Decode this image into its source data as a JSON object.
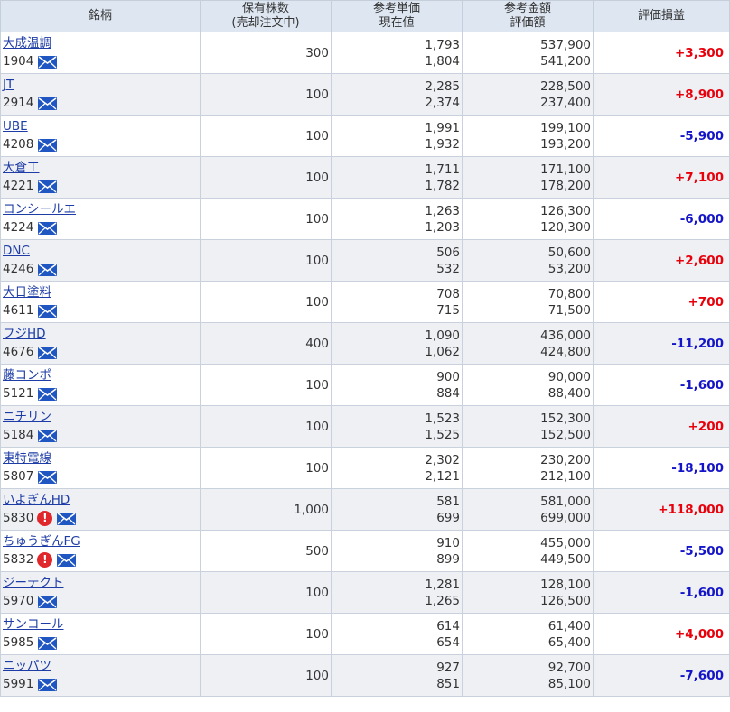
{
  "headers": {
    "col1": "銘柄",
    "col2_line1": "保有株数",
    "col2_line2": "(売却注文中)",
    "col3_line1": "参考単価",
    "col3_line2": "現在値",
    "col4_line1": "参考金額",
    "col4_line2": "評価額",
    "col5": "評価損益"
  },
  "colors": {
    "positive": "#e8000b",
    "negative": "#1414c8",
    "header_bg": "#dde6f1",
    "row_alt_bg": "#eef0f4"
  },
  "rows": [
    {
      "name": "大成温調",
      "code": "1904",
      "alert": false,
      "shares": "300",
      "ref_price": "1,793",
      "cur_price": "1,804",
      "ref_amount": "537,900",
      "cur_amount": "541,200",
      "pl": "+3,300",
      "sign": "pos"
    },
    {
      "name": "JT",
      "code": "2914",
      "alert": false,
      "shares": "100",
      "ref_price": "2,285",
      "cur_price": "2,374",
      "ref_amount": "228,500",
      "cur_amount": "237,400",
      "pl": "+8,900",
      "sign": "pos"
    },
    {
      "name": "UBE",
      "code": "4208",
      "alert": false,
      "shares": "100",
      "ref_price": "1,991",
      "cur_price": "1,932",
      "ref_amount": "199,100",
      "cur_amount": "193,200",
      "pl": "-5,900",
      "sign": "neg"
    },
    {
      "name": "大倉工",
      "code": "4221",
      "alert": false,
      "shares": "100",
      "ref_price": "1,711",
      "cur_price": "1,782",
      "ref_amount": "171,100",
      "cur_amount": "178,200",
      "pl": "+7,100",
      "sign": "pos"
    },
    {
      "name": "ロンシールエ",
      "code": "4224",
      "alert": false,
      "shares": "100",
      "ref_price": "1,263",
      "cur_price": "1,203",
      "ref_amount": "126,300",
      "cur_amount": "120,300",
      "pl": "-6,000",
      "sign": "neg"
    },
    {
      "name": "DNC",
      "code": "4246",
      "alert": false,
      "shares": "100",
      "ref_price": "506",
      "cur_price": "532",
      "ref_amount": "50,600",
      "cur_amount": "53,200",
      "pl": "+2,600",
      "sign": "pos"
    },
    {
      "name": "大日塗料",
      "code": "4611",
      "alert": false,
      "shares": "100",
      "ref_price": "708",
      "cur_price": "715",
      "ref_amount": "70,800",
      "cur_amount": "71,500",
      "pl": "+700",
      "sign": "pos"
    },
    {
      "name": "フジHD",
      "code": "4676",
      "alert": false,
      "shares": "400",
      "ref_price": "1,090",
      "cur_price": "1,062",
      "ref_amount": "436,000",
      "cur_amount": "424,800",
      "pl": "-11,200",
      "sign": "neg"
    },
    {
      "name": "藤コンポ",
      "code": "5121",
      "alert": false,
      "shares": "100",
      "ref_price": "900",
      "cur_price": "884",
      "ref_amount": "90,000",
      "cur_amount": "88,400",
      "pl": "-1,600",
      "sign": "neg"
    },
    {
      "name": "ニチリン",
      "code": "5184",
      "alert": false,
      "shares": "100",
      "ref_price": "1,523",
      "cur_price": "1,525",
      "ref_amount": "152,300",
      "cur_amount": "152,500",
      "pl": "+200",
      "sign": "pos"
    },
    {
      "name": "東特電線",
      "code": "5807",
      "alert": false,
      "shares": "100",
      "ref_price": "2,302",
      "cur_price": "2,121",
      "ref_amount": "230,200",
      "cur_amount": "212,100",
      "pl": "-18,100",
      "sign": "neg"
    },
    {
      "name": "いよぎんHD",
      "code": "5830",
      "alert": true,
      "shares": "1,000",
      "ref_price": "581",
      "cur_price": "699",
      "ref_amount": "581,000",
      "cur_amount": "699,000",
      "pl": "+118,000",
      "sign": "pos"
    },
    {
      "name": "ちゅうぎんFG",
      "code": "5832",
      "alert": true,
      "shares": "500",
      "ref_price": "910",
      "cur_price": "899",
      "ref_amount": "455,000",
      "cur_amount": "449,500",
      "pl": "-5,500",
      "sign": "neg"
    },
    {
      "name": "ジーテクト",
      "code": "5970",
      "alert": false,
      "shares": "100",
      "ref_price": "1,281",
      "cur_price": "1,265",
      "ref_amount": "128,100",
      "cur_amount": "126,500",
      "pl": "-1,600",
      "sign": "neg"
    },
    {
      "name": "サンコール",
      "code": "5985",
      "alert": false,
      "shares": "100",
      "ref_price": "614",
      "cur_price": "654",
      "ref_amount": "61,400",
      "cur_amount": "65,400",
      "pl": "+4,000",
      "sign": "pos"
    },
    {
      "name": "ニッパツ",
      "code": "5991",
      "alert": false,
      "shares": "100",
      "ref_price": "927",
      "cur_price": "851",
      "ref_amount": "92,700",
      "cur_amount": "85,100",
      "pl": "-7,600",
      "sign": "neg"
    }
  ],
  "icons": {
    "mail": "mail-icon",
    "alert": "alert-icon",
    "alert_glyph": "!"
  }
}
